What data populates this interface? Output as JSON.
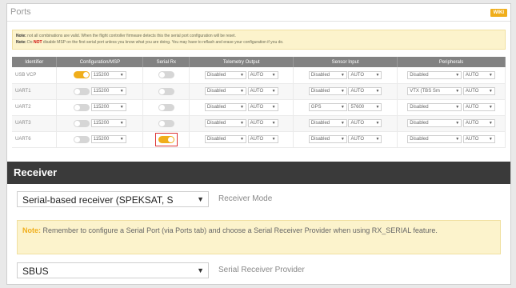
{
  "ports": {
    "title": "Ports",
    "wiki_label": "WIKI",
    "note": {
      "line1_bold": "Note:",
      "line1": "not all combinations are valid. When the flight controller firmware detects this the serial port configuration will be reset.",
      "line2_bold": "Note:",
      "line2_pre": "Do",
      "line2_not": "NOT",
      "line2": "disable MSP on the first serial port unless you know what you are doing. You may have to reflash and erase your configuration if you do."
    },
    "columns": [
      "Identifier",
      "Configuration/MSP",
      "Serial Rx",
      "Telemetry Output",
      "Sensor Input",
      "Peripherals"
    ],
    "rows": [
      {
        "id": "USB VCP",
        "msp_on": true,
        "baud": "115200",
        "rx_on": false,
        "tele": "Disabled",
        "tele_baud": "AUTO",
        "sensor": "Disabled",
        "sensor_baud": "AUTO",
        "periph": "Disabled",
        "periph_baud": "AUTO"
      },
      {
        "id": "UART1",
        "msp_on": false,
        "baud": "115200",
        "rx_on": false,
        "tele": "Disabled",
        "tele_baud": "AUTO",
        "sensor": "Disabled",
        "sensor_baud": "AUTO",
        "periph": "VTX (TBS Sm",
        "periph_baud": "AUTO"
      },
      {
        "id": "UART2",
        "msp_on": false,
        "baud": "115200",
        "rx_on": false,
        "tele": "Disabled",
        "tele_baud": "AUTO",
        "sensor": "GPS",
        "sensor_baud": "57600",
        "periph": "Disabled",
        "periph_baud": "AUTO"
      },
      {
        "id": "UART3",
        "msp_on": false,
        "baud": "115200",
        "rx_on": false,
        "tele": "Disabled",
        "tele_baud": "AUTO",
        "sensor": "Disabled",
        "sensor_baud": "AUTO",
        "periph": "Disabled",
        "periph_baud": "AUTO"
      },
      {
        "id": "UART6",
        "msp_on": false,
        "baud": "115200",
        "rx_on": true,
        "tele": "Disabled",
        "tele_baud": "AUTO",
        "sensor": "Disabled",
        "sensor_baud": "AUTO",
        "periph": "Disabled",
        "periph_baud": "AUTO"
      }
    ]
  },
  "receiver": {
    "title": "Receiver",
    "mode_value": "Serial-based receiver (SPEKSAT, S",
    "mode_label": "Receiver Mode",
    "note_bold": "Note:",
    "note_text": "Remember to configure a Serial Port (via Ports tab) and choose a Serial Receiver Provider when using RX_SERIAL feature.",
    "provider_value": "SBUS",
    "provider_label": "Serial Receiver Provider"
  },
  "colors": {
    "accent": "#f0ae1b",
    "header_bg": "#828282",
    "receiver_bg": "#3a3a3a",
    "note_bg": "#fcf3cc",
    "highlight": "#dd3333"
  }
}
